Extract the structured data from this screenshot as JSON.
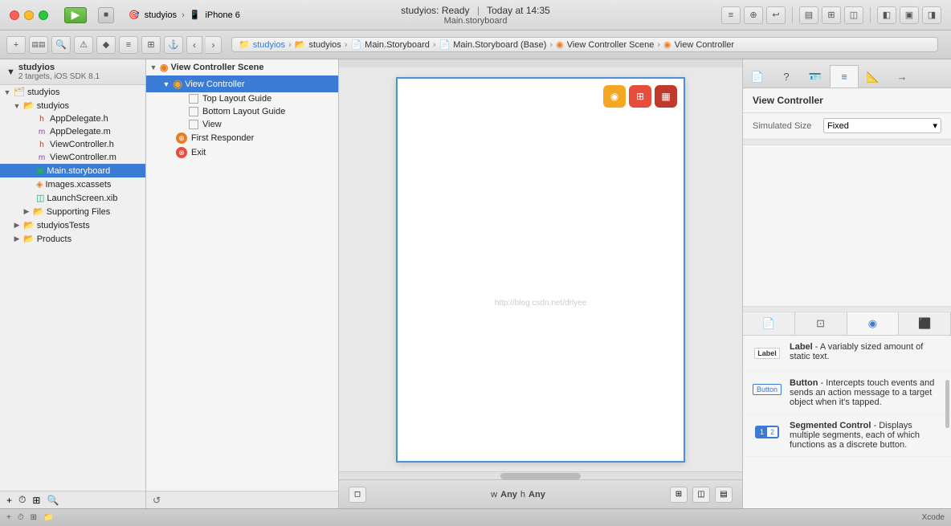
{
  "window": {
    "title": "Main.storyboard"
  },
  "titlebar": {
    "traffic_close": "●",
    "traffic_min": "●",
    "traffic_max": "●",
    "app_name": "studyios",
    "device": "iPhone 6",
    "status": "studyios: Ready",
    "time": "Today at 14:35"
  },
  "toolbar": {
    "breadcrumb_items": [
      {
        "label": "studyios",
        "type": "project"
      },
      {
        "label": "studyios",
        "type": "folder"
      },
      {
        "label": "Main.Storyboard",
        "type": "storyboard"
      },
      {
        "label": "Main.Storyboard (Base)",
        "type": "base"
      },
      {
        "label": "View Controller Scene",
        "type": "scene"
      },
      {
        "label": "View Controller",
        "type": "vc"
      }
    ]
  },
  "sidebar": {
    "project_name": "studyios",
    "project_sub": "2 targets, iOS SDK 8.1",
    "tree": [
      {
        "id": "studyios-root",
        "label": "studyios",
        "indent": 0,
        "type": "project",
        "expanded": true,
        "icon": "📁"
      },
      {
        "id": "studyios-group",
        "label": "studyios",
        "indent": 1,
        "type": "folder",
        "expanded": true,
        "icon": "📂"
      },
      {
        "id": "AppDelegate.h",
        "label": "AppDelegate.h",
        "indent": 2,
        "type": "h",
        "icon": "h"
      },
      {
        "id": "AppDelegate.m",
        "label": "AppDelegate.m",
        "indent": 2,
        "type": "m",
        "icon": "m"
      },
      {
        "id": "ViewController.h",
        "label": "ViewController.h",
        "indent": 2,
        "type": "h",
        "icon": "h"
      },
      {
        "id": "ViewController.m",
        "label": "ViewController.m",
        "indent": 2,
        "type": "m",
        "icon": "m"
      },
      {
        "id": "Main.storyboard",
        "label": "Main.storyboard",
        "indent": 2,
        "type": "storyboard",
        "selected": true,
        "icon": "s"
      },
      {
        "id": "Images.xcassets",
        "label": "Images.xcassets",
        "indent": 2,
        "type": "xcassets",
        "icon": "x"
      },
      {
        "id": "LaunchScreen.xib",
        "label": "LaunchScreen.xib",
        "indent": 2,
        "type": "xib",
        "icon": "x"
      },
      {
        "id": "Supporting Files",
        "label": "Supporting Files",
        "indent": 2,
        "type": "folder",
        "icon": "📂"
      },
      {
        "id": "studyiosTests",
        "label": "studyiosTests",
        "indent": 1,
        "type": "folder",
        "icon": "📂"
      },
      {
        "id": "Products",
        "label": "Products",
        "indent": 1,
        "type": "folder",
        "icon": "📂"
      }
    ]
  },
  "scene_outline": {
    "sections": [
      {
        "label": "View Controller Scene",
        "items": [
          {
            "id": "vc-node",
            "label": "View Controller",
            "indent": 1,
            "expanded": true,
            "selected": true,
            "icon": "vc"
          },
          {
            "id": "top-layout",
            "label": "Top Layout Guide",
            "indent": 2,
            "icon": "rect"
          },
          {
            "id": "bottom-layout",
            "label": "Bottom Layout Guide",
            "indent": 2,
            "icon": "rect"
          },
          {
            "id": "view-node",
            "label": "View",
            "indent": 2,
            "icon": "rect"
          },
          {
            "id": "first-responder",
            "label": "First Responder",
            "indent": 1,
            "icon": "fr"
          },
          {
            "id": "exit-node",
            "label": "Exit",
            "indent": 1,
            "icon": "exit"
          }
        ]
      }
    ]
  },
  "canvas": {
    "watermark": "http://blog.csdn.net/drlyee",
    "arrow_label": "→",
    "bottom_size_label": "w Any  h Any"
  },
  "inspector": {
    "title": "View Controller",
    "tabs": [
      {
        "id": "file",
        "icon": "📄"
      },
      {
        "id": "help",
        "icon": "?"
      },
      {
        "id": "identity",
        "icon": "🆔"
      },
      {
        "id": "attributes",
        "icon": "≡"
      },
      {
        "id": "size",
        "icon": "📐"
      },
      {
        "id": "connections",
        "icon": "→"
      }
    ],
    "simulated_size_label": "Simulated Size",
    "simulated_size_value": "Fixed",
    "obj_library_tabs": [
      {
        "id": "objects",
        "icon": "◻"
      },
      {
        "id": "media",
        "icon": "⬜"
      },
      {
        "id": "selected",
        "icon": "◉",
        "active": true
      },
      {
        "id": "snippets",
        "icon": "⬛"
      }
    ],
    "objects": [
      {
        "id": "label",
        "name": "Label",
        "desc_prefix": " - A variably sized amount of static text.",
        "type": "label"
      },
      {
        "id": "button",
        "name": "Button",
        "desc_prefix": " - Intercepts touch events and sends an action message to a target object when it's tapped.",
        "type": "button"
      },
      {
        "id": "segmented",
        "name": "Segmented Control",
        "desc_prefix": " - Displays multiple segments, each of which functions as a discrete button.",
        "type": "segmented"
      }
    ]
  },
  "statusbar": {
    "left": "",
    "right": "Xcode"
  }
}
